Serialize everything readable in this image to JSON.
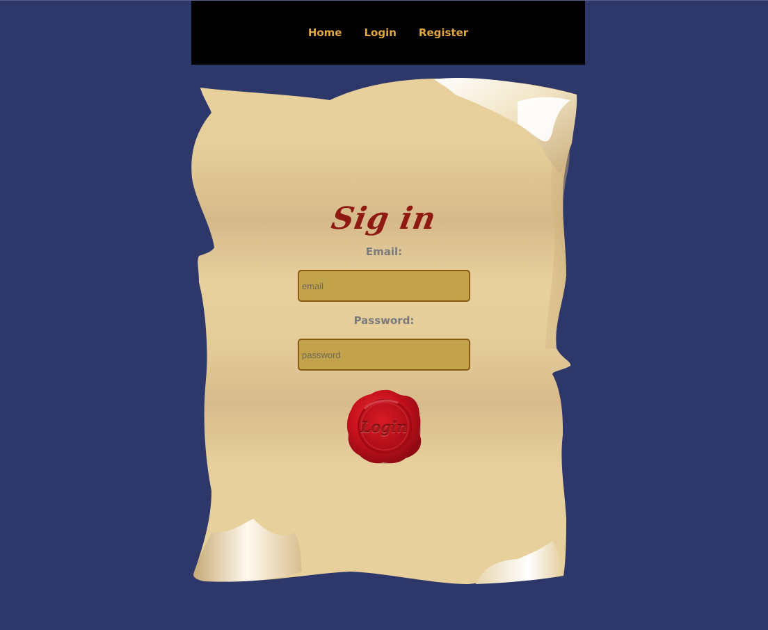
{
  "nav": {
    "items": [
      {
        "label": "Home"
      },
      {
        "label": "Login"
      },
      {
        "label": "Register"
      }
    ]
  },
  "form": {
    "title": "Sig in",
    "email_label": "Email:",
    "email_placeholder": "email",
    "password_label": "Password:",
    "password_placeholder": "password",
    "submit_label": "Login"
  },
  "colors": {
    "background": "#2e376a",
    "nav_background": "#000000",
    "nav_link": "#e0a640",
    "title": "#8e1a12",
    "field_background": "#c3a24c",
    "field_border": "#8a5b14",
    "seal": "#c8141f"
  },
  "icons": {
    "scroll": "parchment-scroll-icon",
    "seal": "wax-seal-icon"
  }
}
